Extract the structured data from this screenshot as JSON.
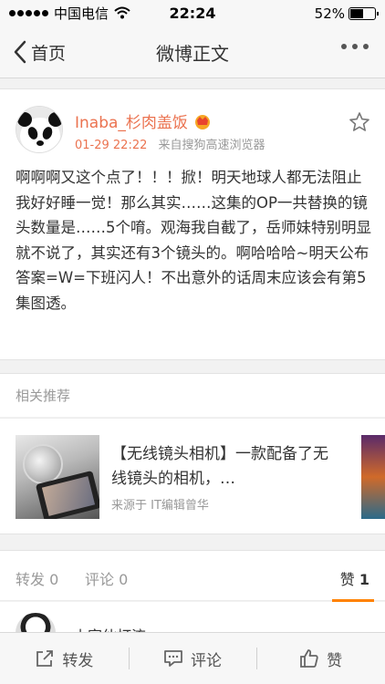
{
  "status_bar": {
    "carrier": "中国电信",
    "time": "22:24",
    "battery_percent": "52%",
    "battery_level": 0.52,
    "icons": [
      "signal-dots-icon",
      "wifi-icon",
      "battery-icon"
    ]
  },
  "nav": {
    "back_label": "首页",
    "title": "微博正文",
    "icons": [
      "chevron-left-icon",
      "more-dots-icon"
    ]
  },
  "post": {
    "author": "Inaba_杉肉盖饭",
    "date": "01-29 22:22",
    "source": "来自搜狗高速浏览器",
    "text": "啊啊啊又这个点了！！！掀！明天地球人都无法阻止我好好睡一觉！那么其实……这集的OP一共替换的镜头数量是……5个唷。观海我自截了，岳师妹特别明显就不说了，其实还有3个镜头的。啊哈哈哈~明天公布答案=W=下班闪人！不出意外的话周末应该会有第5集图透。",
    "icons": [
      "panda-avatar",
      "crown-badge-icon",
      "star-icon"
    ]
  },
  "related": {
    "header": "相关推荐",
    "item_title": "【无线镜头相机】一款配备了无线镜头的相机，…",
    "item_source": "来源于 IT编辑曾华"
  },
  "tabs": {
    "repost": "转发 0",
    "comment": "评论 0",
    "like_label": "赞",
    "like_count": "1"
  },
  "comment_preview": {
    "name": "小家伙打流"
  },
  "toolbar": {
    "repost": "转发",
    "comment": "评论",
    "like": "赞",
    "icons": [
      "share-icon",
      "comment-icon",
      "thumbs-up-icon"
    ]
  },
  "colors": {
    "accent": "#eb7350",
    "tab_underline": "#ff8200",
    "text": "#333333",
    "muted": "#999999"
  }
}
